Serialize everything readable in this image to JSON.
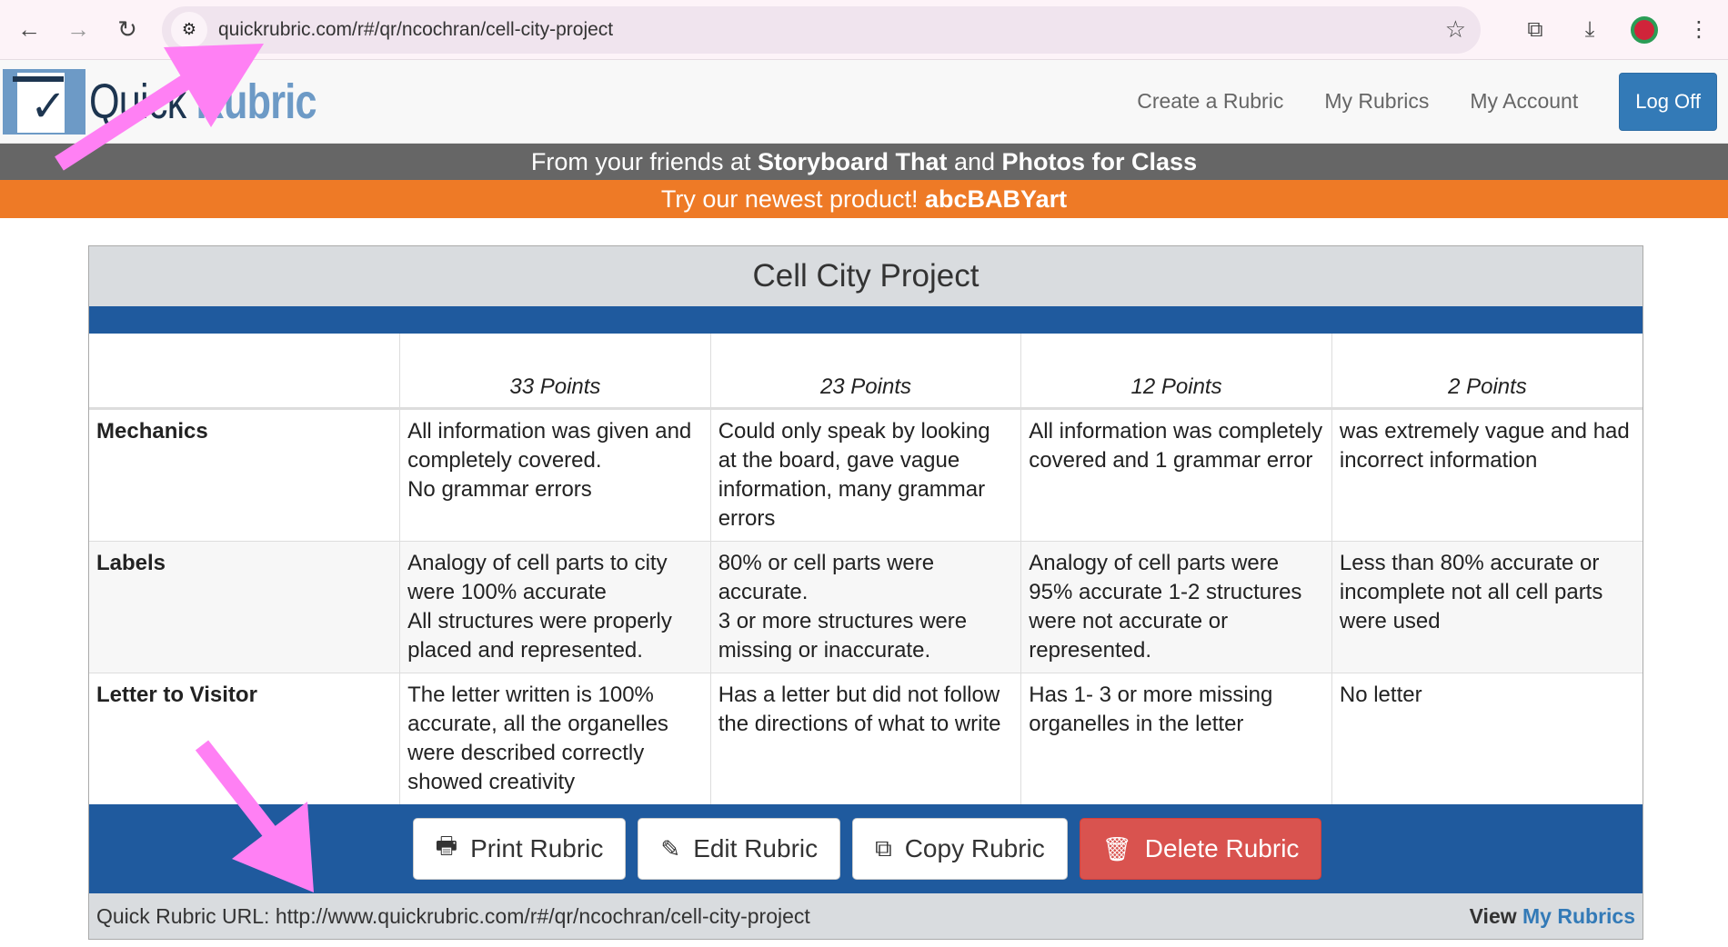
{
  "browser": {
    "url": "quickrubric.com/r#/qr/ncochran/cell-city-project"
  },
  "nav": {
    "logo_quick": "Quick",
    "logo_rubric": "Rubric",
    "links": [
      "Create a Rubric",
      "My Rubrics",
      "My Account"
    ],
    "logoff": "Log Off"
  },
  "banner1": {
    "prefix": "From your friends at ",
    "brand1": "Storyboard That",
    "mid": " and ",
    "brand2": "Photos for Class"
  },
  "banner2": {
    "prefix": "Try our newest product! ",
    "product": "abcBABYart"
  },
  "rubric": {
    "title": "Cell City Project",
    "headers": [
      "",
      "33 Points",
      "23 Points",
      "12 Points",
      "2 Points"
    ],
    "rows": [
      {
        "criterion": "Mechanics",
        "cells": [
          "All information was given and completely covered.\nNo grammar errors",
          "Could only speak by looking at the board, gave vague information, many grammar errors",
          "All information was completely covered and 1 grammar error",
          "was extremely vague and had incorrect information"
        ]
      },
      {
        "criterion": "Labels",
        "cells": [
          "Analogy of cell parts to city were 100% accurate\nAll structures were properly placed and represented.",
          "80% or cell parts were accurate.\n3 or more structures were missing or inaccurate.",
          "Analogy of cell parts were 95% accurate 1-2 structures were not accurate or represented.",
          "Less than 80% accurate or incomplete not all cell parts were used"
        ]
      },
      {
        "criterion": "Letter to Visitor",
        "cells": [
          "The letter written is 100% accurate, all the organelles were described correctly showed creativity",
          "Has a letter but did not follow the directions of what to write",
          "Has 1- 3 or more missing organelles in the letter",
          "No letter"
        ]
      }
    ],
    "buttons": {
      "print": "Print Rubric",
      "edit": "Edit Rubric",
      "copy": "Copy Rubric",
      "delete": "Delete Rubric"
    },
    "footer": {
      "label": "Quick Rubric URL: http://www.quickrubric.com/r#/qr/ncochran/cell-city-project",
      "view": "View ",
      "my_rubrics": "My Rubrics"
    }
  },
  "colors": {
    "accent_blue": "#1f5a9e",
    "orange": "#ee7a26",
    "delete_red": "#d9534f",
    "annotation_arrow": "#ff80f4"
  }
}
